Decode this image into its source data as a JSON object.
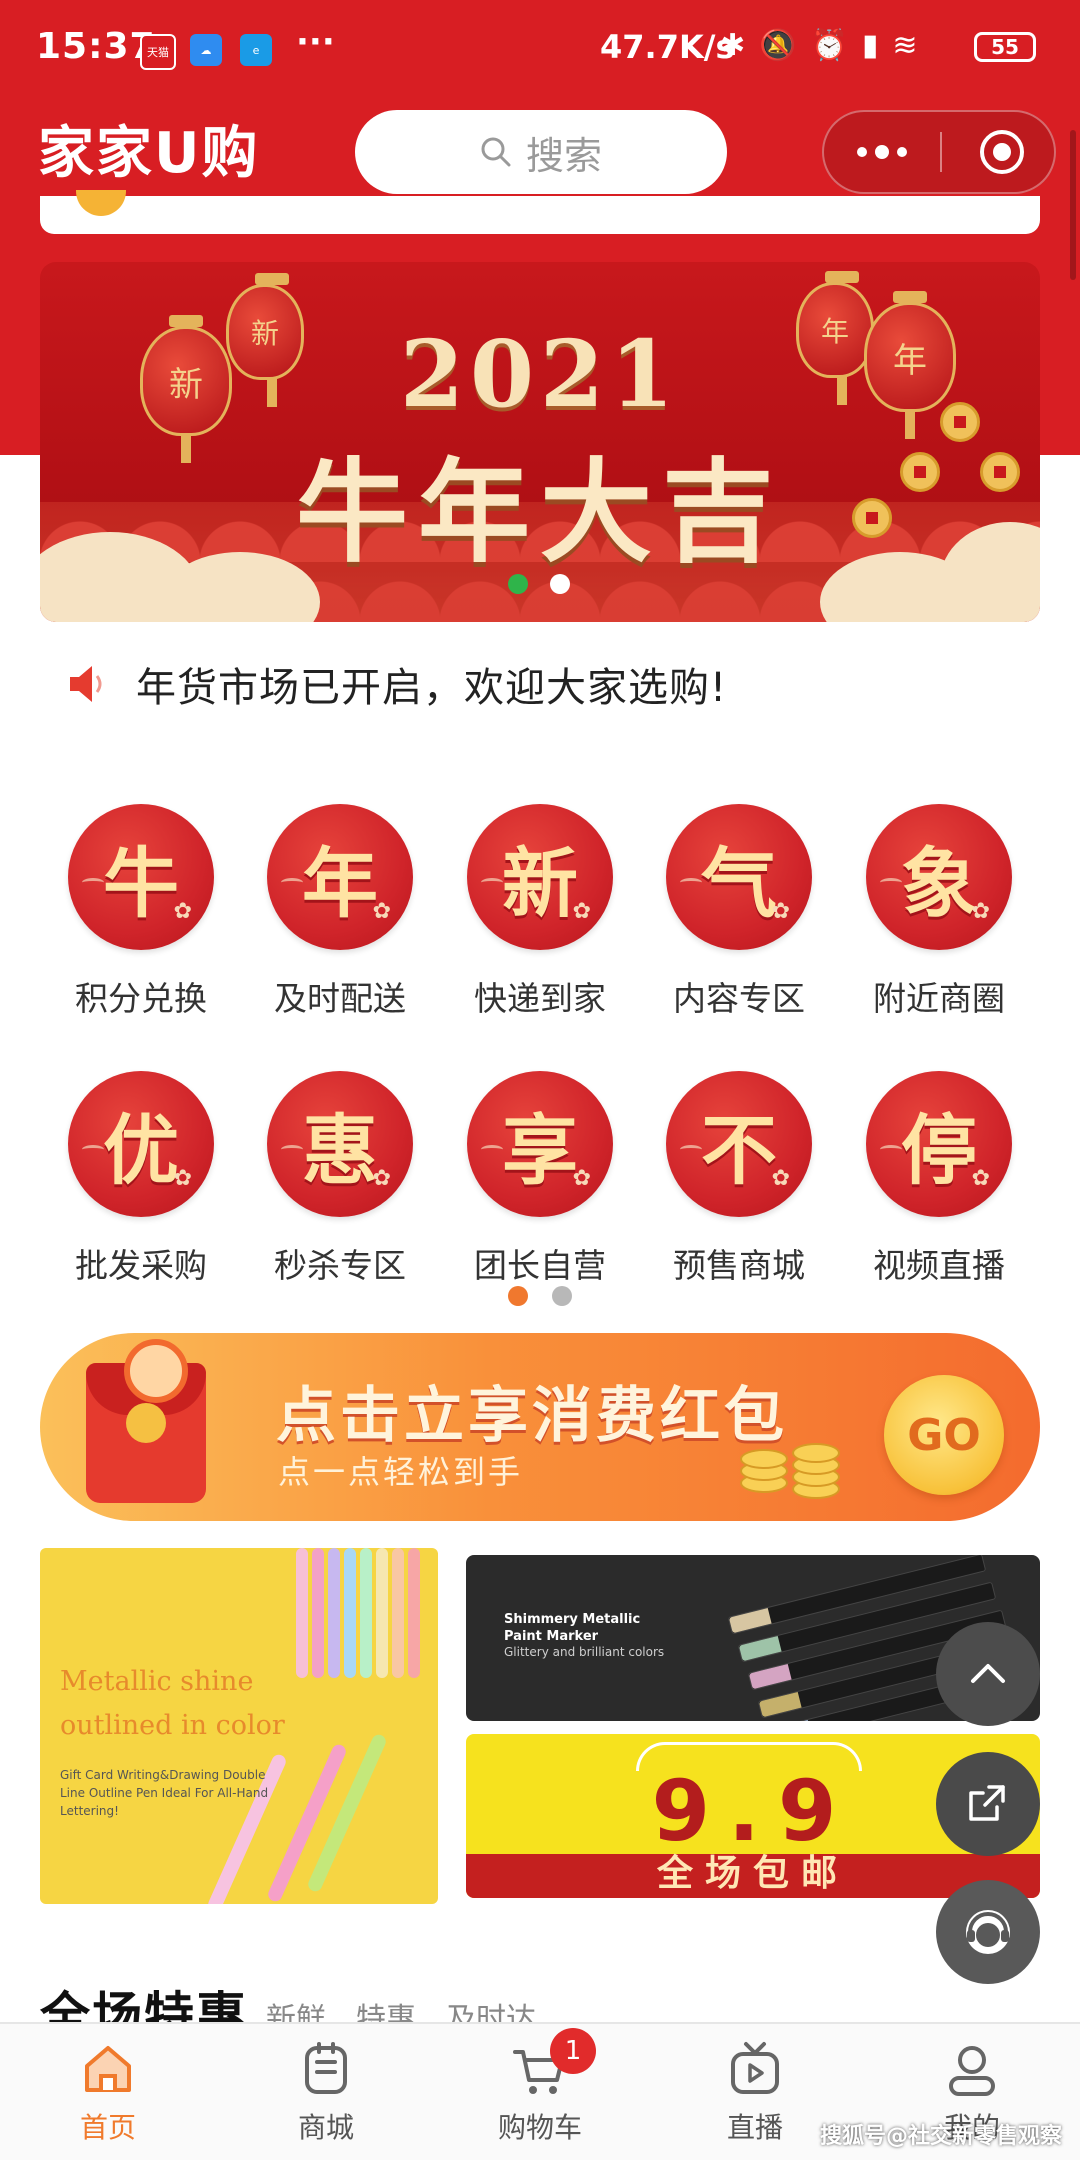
{
  "status_bar": {
    "time": "15:37",
    "app_icons": [
      "天猫",
      "cloud",
      "ele"
    ],
    "more": "···",
    "net_speed": "47.7K/s",
    "battery": "55"
  },
  "header": {
    "app_name": "家家U购",
    "search_placeholder": "搜索"
  },
  "banner": {
    "year": "2021",
    "slogan": "牛年大吉",
    "lantern_char": "新",
    "lantern_char_2": "年",
    "slides_total": 2,
    "active_slide": 1
  },
  "notice": {
    "text": "年货市场已开启，欢迎大家选购!"
  },
  "grid": {
    "items": [
      {
        "char": "牛",
        "label": "积分兑换"
      },
      {
        "char": "年",
        "label": "及时配送"
      },
      {
        "char": "新",
        "label": "快递到家"
      },
      {
        "char": "气",
        "label": "内容专区"
      },
      {
        "char": "象",
        "label": "附近商圈"
      },
      {
        "char": "优",
        "label": "批发采购"
      },
      {
        "char": "惠",
        "label": "秒杀专区"
      },
      {
        "char": "享",
        "label": "团长自营"
      },
      {
        "char": "不",
        "label": "预售商城"
      },
      {
        "char": "停",
        "label": "视频直播"
      }
    ],
    "pages_total": 2,
    "active_page": 1
  },
  "promo": {
    "title": "点击立享消费红包",
    "subtitle": "点一点轻松到手",
    "go": "GO"
  },
  "tiles": {
    "pens_title_1": "Metallic shine",
    "pens_title_2": "outlined in color",
    "pens_desc": "Gift Card Writing&Drawing Double Line Outline Pen Ideal For All-Hand Lettering!",
    "marker_title_1": "Shimmery Metallic",
    "marker_title_2": "Paint Marker",
    "marker_desc": "Glittery and brilliant colors",
    "sale_price": "9.9",
    "sale_text": "全场包邮"
  },
  "section": {
    "title": "全场特惠",
    "subtitle": "新鲜、特惠、及时达"
  },
  "tab_bar": {
    "tabs": [
      {
        "label": "首页",
        "icon": "home-icon",
        "active": true
      },
      {
        "label": "商城",
        "icon": "store-icon",
        "active": false
      },
      {
        "label": "购物车",
        "icon": "cart-icon",
        "active": false
      },
      {
        "label": "直播",
        "icon": "live-icon",
        "active": false
      },
      {
        "label": "我的",
        "icon": "profile-icon",
        "active": false
      }
    ],
    "cart_badge": "1"
  },
  "watermark": "搜狐号@社交新零售观察",
  "colors": {
    "brand_red": "#d81e23",
    "active_tab": "#f07a2c",
    "banner_dot_active": "#2fb44a",
    "page_dot_active": "#f0782e"
  }
}
